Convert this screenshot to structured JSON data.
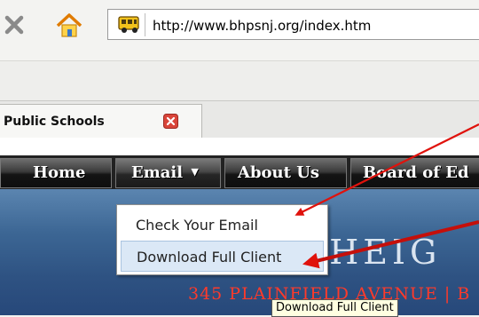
{
  "browser": {
    "url": "http://www.bhpsnj.org/index.htm",
    "icons": {
      "stop": "close-x-icon",
      "home": "home-icon",
      "site": "school-bus-icon"
    }
  },
  "tabs": [
    {
      "title": "Public Schools",
      "close_icon": "tab-close-icon"
    }
  ],
  "site_nav": {
    "items": [
      {
        "label": "Home"
      },
      {
        "label": "Email",
        "has_dropdown": true
      },
      {
        "label": "About Us"
      },
      {
        "label": "Board of Ed"
      }
    ]
  },
  "email_menu": {
    "items": [
      {
        "label": "Check Your Email"
      },
      {
        "label": "Download Full Client",
        "highlighted": true
      }
    ]
  },
  "tooltip": "Download Full Client",
  "banner": {
    "title_fragment": "Y HEIG",
    "address_fragment": "345 PLAINFIELD AVENUE | B"
  },
  "colors": {
    "annotation_arrow": "#e0120c",
    "menu_highlight": "#dbe8f6",
    "address_text": "#ff3a2a"
  }
}
